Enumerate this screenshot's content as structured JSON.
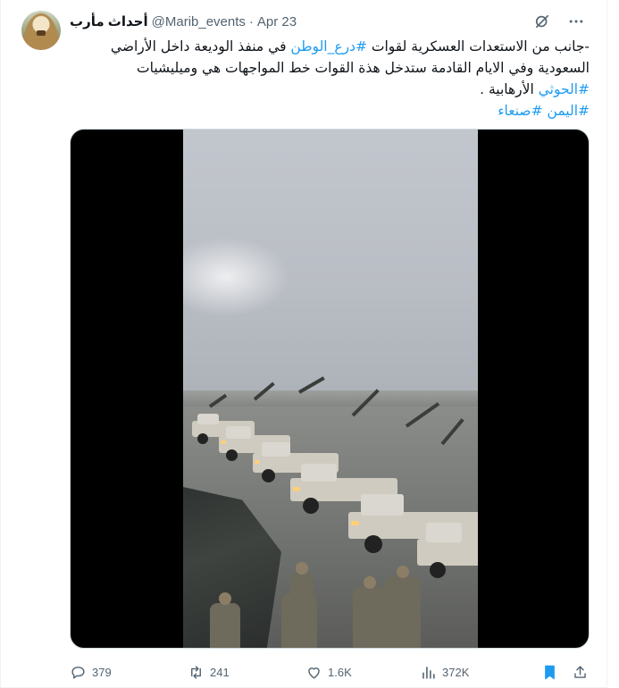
{
  "post": {
    "author_name": "أحداث مأرب",
    "handle": "@Marib_events",
    "separator": "·",
    "date": "Apr 23",
    "text_line1_before": "-جانب من الاستعدات العسكرية لقوات ",
    "hashtag_dir3": "#درع_الوطن",
    "text_line1_after": " في منفذ الوديعة داخل الأراضي",
    "text_line2": "السعودية وفي الايام القادمة ستدخل هذة القوات خط المواجهات هي وميليشيات",
    "hashtag_houthi": "#الحوثي",
    "text_line3_after": " الأرهابية .",
    "hashtag_yemen": "#اليمن",
    "hashtag_sanaa": "#صنعاء"
  },
  "icons": {
    "grok": "grok-icon",
    "more": "more-dots-icon",
    "reply": "reply-icon",
    "repost": "repost-icon",
    "like": "heart-icon",
    "views": "views-chart-icon",
    "bookmark": "bookmark-icon",
    "share": "share-icon"
  },
  "metrics": {
    "replies": "379",
    "reposts": "241",
    "likes": "1.6K",
    "views": "372K"
  },
  "colors": {
    "accent": "#1d9bf0",
    "secondary_text": "#536471",
    "primary_text": "#0f1419"
  }
}
